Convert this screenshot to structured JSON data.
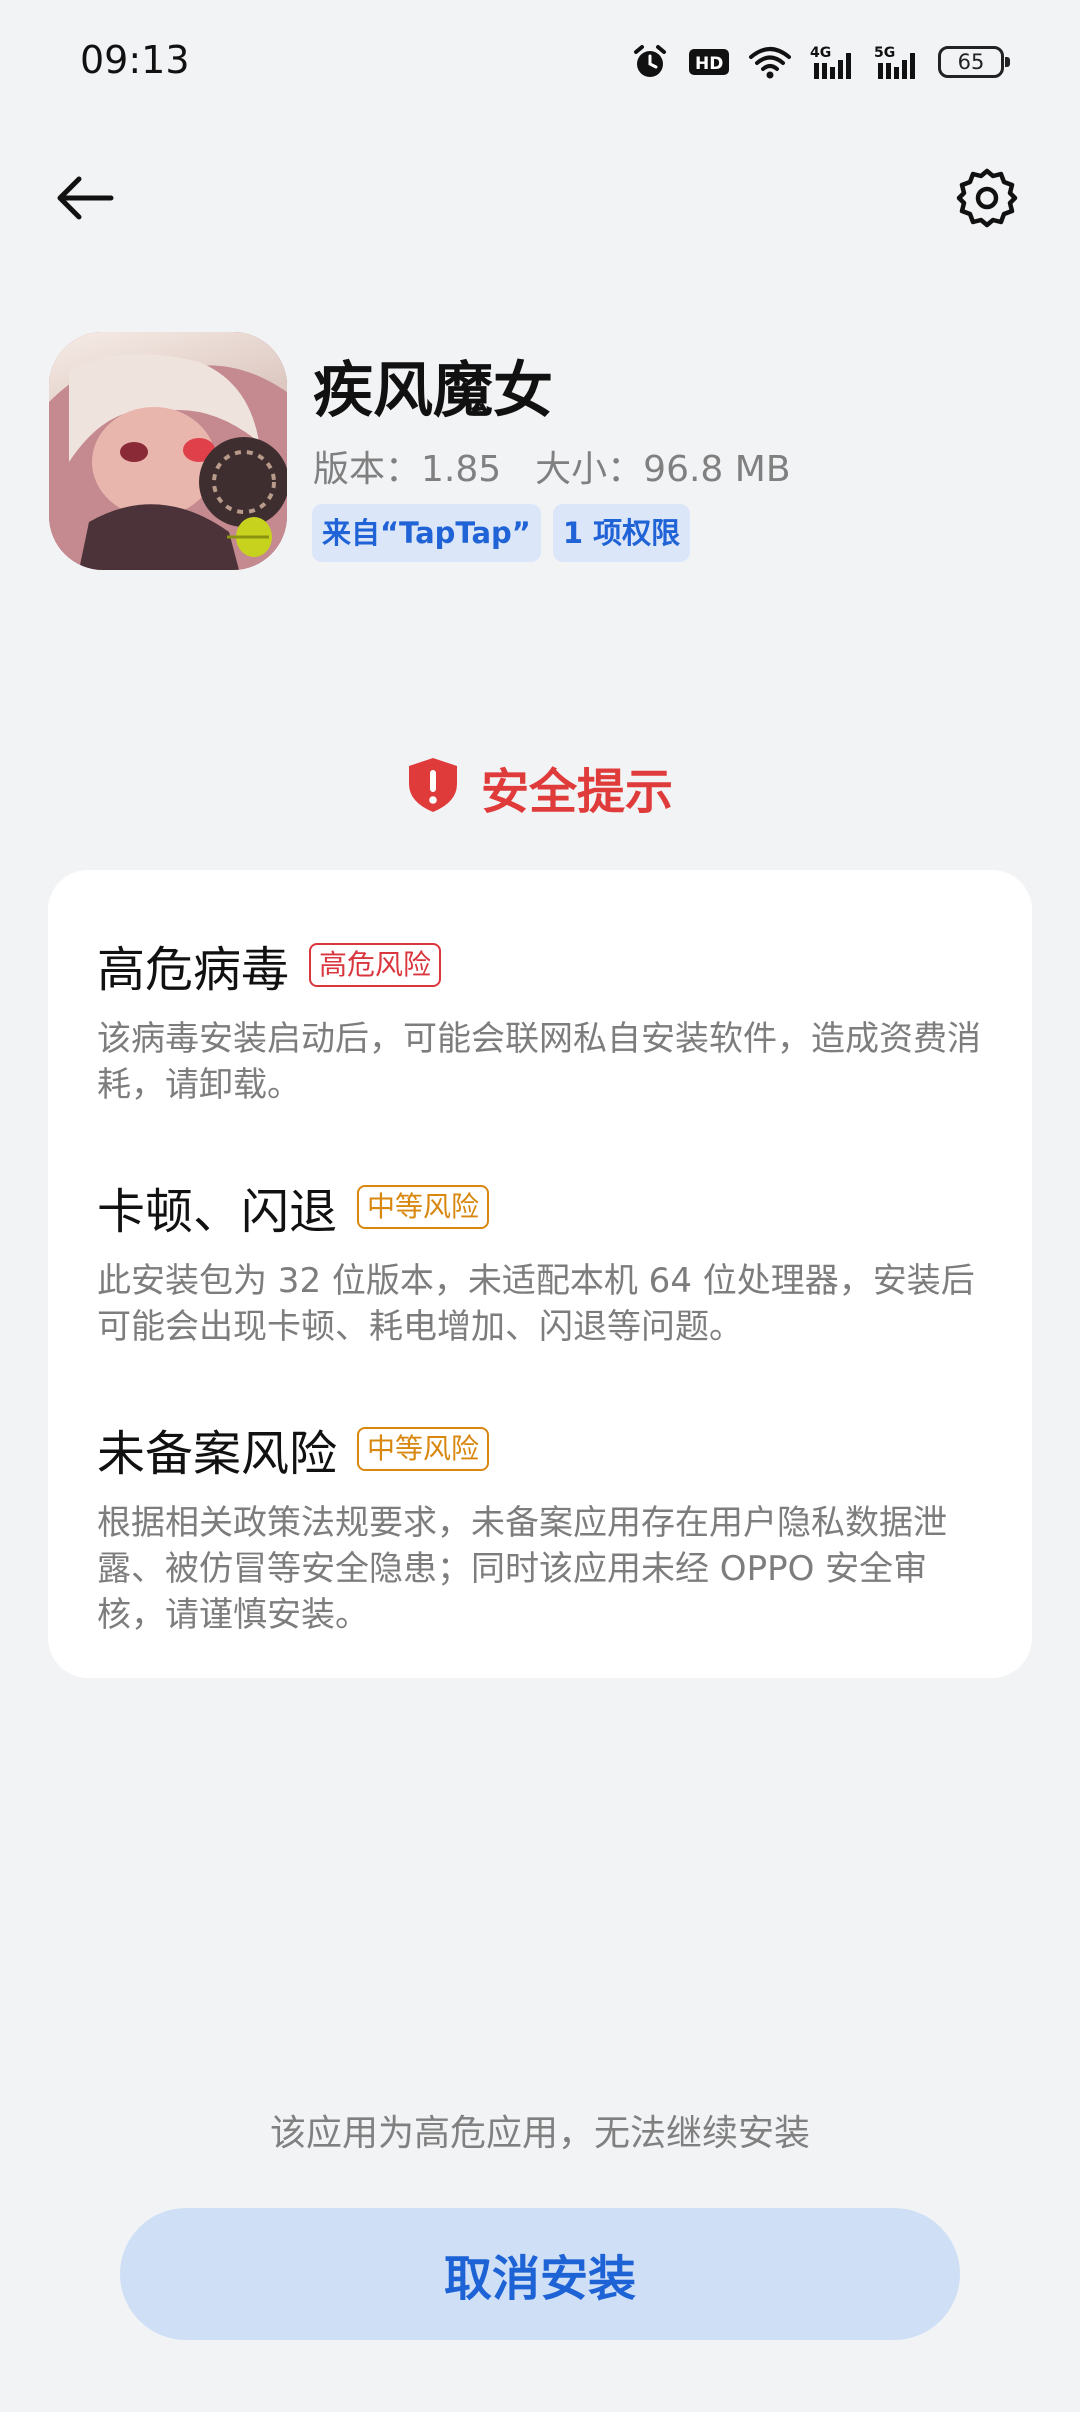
{
  "status_bar": {
    "time": "09:13",
    "battery": "65"
  },
  "app": {
    "name": "疾风魔女",
    "version_label": "版本：1.85",
    "size_label": "大小：96.8 MB",
    "source_tag": "来自“TapTap”",
    "permission_tag": "1 项权限"
  },
  "security": {
    "title": "安全提示",
    "items": [
      {
        "title": "高危病毒",
        "badge": "高危风险",
        "desc": "该病毒安装启动后，可能会联网私自安装软件，造成资费消耗，请卸载。"
      },
      {
        "title": "卡顿、闪退",
        "badge": "中等风险",
        "desc": "此安装包为 32 位版本，未适配本机 64 位处理器，安装后可能会出现卡顿、耗电增加、闪退等问题。"
      },
      {
        "title": "未备案风险",
        "badge": "中等风险",
        "desc": "根据相关政策法规要求，未备案应用存在用户隐私数据泄露、被仿冒等安全隐患；同时该应用未经 OPPO 安全审核，请谨慎安装。"
      }
    ]
  },
  "footer": {
    "note": "该应用为高危应用，无法继续安装",
    "cancel_label": "取消安装"
  },
  "colors": {
    "accent": "#1f63d6",
    "danger": "#e03b3b",
    "warning": "#d8870f",
    "background": "#f2f3f5"
  },
  "icons": [
    "alarm-icon",
    "hd-icon",
    "wifi-icon",
    "signal-4g-icon",
    "signal-5g-icon",
    "battery-icon",
    "back-arrow-icon",
    "gear-icon",
    "shield-alert-icon"
  ]
}
